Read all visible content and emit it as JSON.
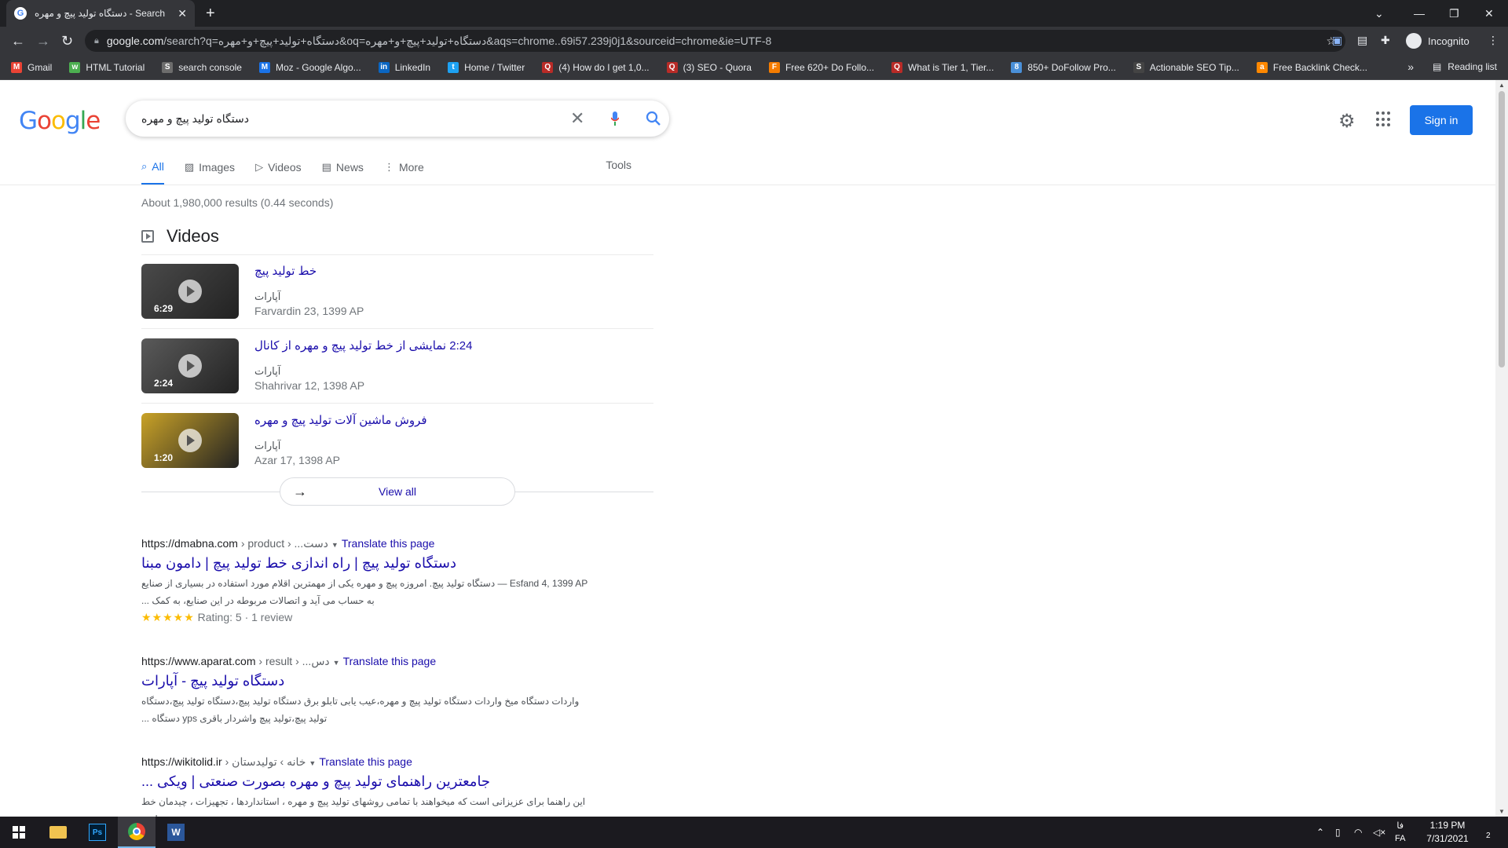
{
  "browser": {
    "tab_title": "دستگاه تولید پیچ و مهره - Google Search",
    "tab_title_display": "دستگاه تولید پیچ و مهره - Search",
    "url_host": "google.com",
    "url_rest": "/search?q=دستگاه+تولید+پیچ+و+مهره&oq=دستگاه+تولید+پیچ+و+مهره&aqs=chrome..69i57.239j0j1&sourceid=chrome&ie=UTF-8",
    "profile_label": "Incognito",
    "bookmarks": [
      {
        "label": "Gmail",
        "icon": "gmail-icon",
        "color": "#ea4335",
        "glyph": "M"
      },
      {
        "label": "HTML Tutorial",
        "icon": "w3schools-icon",
        "color": "#4caf50",
        "glyph": "w"
      },
      {
        "label": "search console",
        "icon": "search-console-icon",
        "color": "#6d6d6d",
        "glyph": "S"
      },
      {
        "label": "Moz - Google Algo...",
        "icon": "moz-icon",
        "color": "#1a73e8",
        "glyph": "M"
      },
      {
        "label": "LinkedIn",
        "icon": "linkedin-icon",
        "color": "#0a66c2",
        "glyph": "in"
      },
      {
        "label": "Home / Twitter",
        "icon": "twitter-icon",
        "color": "#1da1f2",
        "glyph": "t"
      },
      {
        "label": "(4) How do I get 1,0...",
        "icon": "quora-icon",
        "color": "#b92b27",
        "glyph": "Q"
      },
      {
        "label": "(3) SEO - Quora",
        "icon": "quora-icon",
        "color": "#b92b27",
        "glyph": "Q"
      },
      {
        "label": "Free 620+ Do Follo...",
        "icon": "bookmark-site-icon",
        "color": "#f57c00",
        "glyph": "F"
      },
      {
        "label": "What is Tier 1, Tier...",
        "icon": "quora-icon",
        "color": "#b92b27",
        "glyph": "Q"
      },
      {
        "label": "850+ DoFollow Pro...",
        "icon": "bookmark-site-icon",
        "color": "#4a90d9",
        "glyph": "8"
      },
      {
        "label": "Actionable SEO Tip...",
        "icon": "bookmark-site-icon",
        "color": "#444444",
        "glyph": "S"
      },
      {
        "label": "Free Backlink Check...",
        "icon": "ahrefs-icon",
        "color": "#ff8800",
        "glyph": "a"
      }
    ],
    "reading_list": "Reading list",
    "more_bookmarks": "»"
  },
  "google": {
    "query": "دستگاه تولید پیچ و مهره",
    "sign_in": "Sign in",
    "tabs": [
      {
        "label": "All",
        "icon": "search-icon",
        "active": true
      },
      {
        "label": "Images",
        "icon": "images-icon",
        "active": false
      },
      {
        "label": "Videos",
        "icon": "videos-icon",
        "active": false
      },
      {
        "label": "News",
        "icon": "news-icon",
        "active": false
      },
      {
        "label": "More",
        "icon": "more-icon",
        "active": false
      }
    ],
    "tools": "Tools",
    "stats": "About 1,980,000 results (0.44 seconds)",
    "videos_heading": "Videos",
    "videos": [
      {
        "title": "خط تولید پیچ",
        "source": "آپارات",
        "date": "Farvardin 23, 1399 AP",
        "duration": "6:29",
        "thumb_color": "#4a4a4a"
      },
      {
        "title": "2:24 نمایشی از خط تولید پیچ و مهره از کانال",
        "source": "آپارات",
        "date": "Shahrivar 12, 1398 AP",
        "duration": "2:24",
        "thumb_color": "#5a5a5a"
      },
      {
        "title": "فروش ماشین آلات تولید پیچ و مهره",
        "source": "آپارات",
        "date": "Azar 17, 1398 AP",
        "duration": "1:20",
        "thumb_color": "#c9a227"
      }
    ],
    "view_all": "View all",
    "results": [
      {
        "url": "https://dmabna.com",
        "path": " › product › ...دست",
        "translate": "Translate this page",
        "title": "دستگاه تولید پیچ | راه اندازی خط تولید پیچ | دامون مبنا",
        "snippet": "Esfand 4, 1399 AP — دستگاه تولید پیچ. امروزه پیچ و مهره یکی از مهمترین اقلام مورد استفاده در بسیاری از صنایع به حساب می آید و اتصالات مربوطه در این صنایع، به کمک ...",
        "rating": "Rating: 5 · 1 review",
        "stars": "★★★★★"
      },
      {
        "url": "https://www.aparat.com",
        "path": " › result › ...دس",
        "translate": "Translate this page",
        "title": "دستگاه تولید پیچ - آپارات",
        "snippet": "واردات دستگاه میخ واردات دستگاه تولید پیچ و مهره،عیب یابی تابلو برق دستگاه تولید پیچ،دستگاه تولید پیچ،دستگاه تولید پیچ،تولید پیچ واشردار باقری yps دستگاه ...",
        "rating": "",
        "stars": ""
      },
      {
        "url": "https://wikitolid.ir",
        "path": " › خانه › تولیدستان",
        "translate": "Translate this page",
        "title": "جامعترین راهنمای تولید پیچ و مهره بصورت صنعتی | ویکی ...",
        "snippet": "این راهنما برای عزیزانی است که میخواهند با تمامی روشهای تولید پیچ و مهره ، استانداردها ، تجهیزات ، چیدمان خط تولید ،",
        "rating": "",
        "stars": ""
      }
    ]
  },
  "taskbar": {
    "lang1": "فا",
    "lang2": "FA",
    "time": "1:19 PM",
    "date": "7/31/2021",
    "notif_count": "2"
  }
}
